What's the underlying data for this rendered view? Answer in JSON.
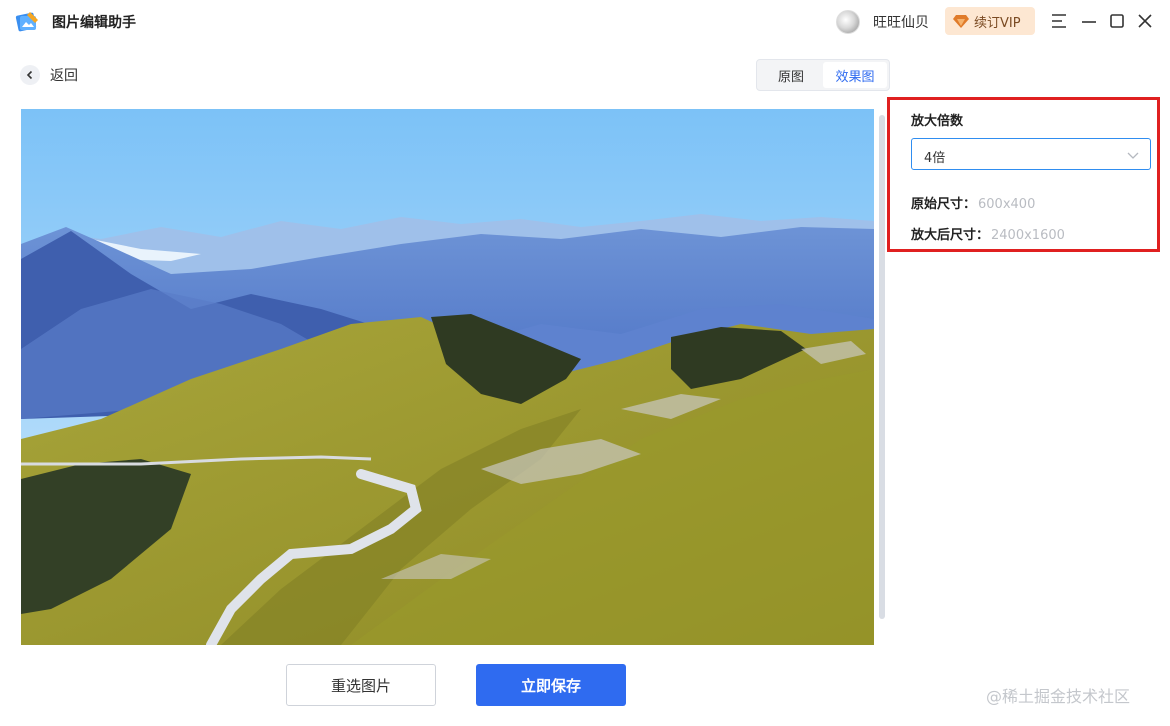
{
  "app": {
    "title": "图片编辑助手",
    "username": "旺旺仙贝",
    "vip_label": "续订VIP",
    "icons": {
      "logo": "image-editor-logo-icon",
      "vip": "diamond-icon",
      "menu": "menu-icon",
      "minimize": "minimize-icon",
      "maximize": "maximize-icon",
      "close": "close-icon"
    }
  },
  "nav": {
    "back_label": "返回",
    "back_icon": "chevron-left-icon"
  },
  "view_tabs": {
    "original": "原图",
    "result": "效果图",
    "active": "result"
  },
  "settings": {
    "scale_title": "放大倍数",
    "scale_value": "4倍",
    "original_size_label": "原始尺寸：",
    "original_size_value": "600x400",
    "enlarged_size_label": "放大后尺寸：",
    "enlarged_size_value": "2400x1600"
  },
  "actions": {
    "reselect": "重选图片",
    "save": "立即保存"
  },
  "watermark": "@稀土掘金技术社区",
  "colors": {
    "primary": "#2f6bf0",
    "highlight_border": "#e02020",
    "vip_bg": "#fde7d2"
  }
}
